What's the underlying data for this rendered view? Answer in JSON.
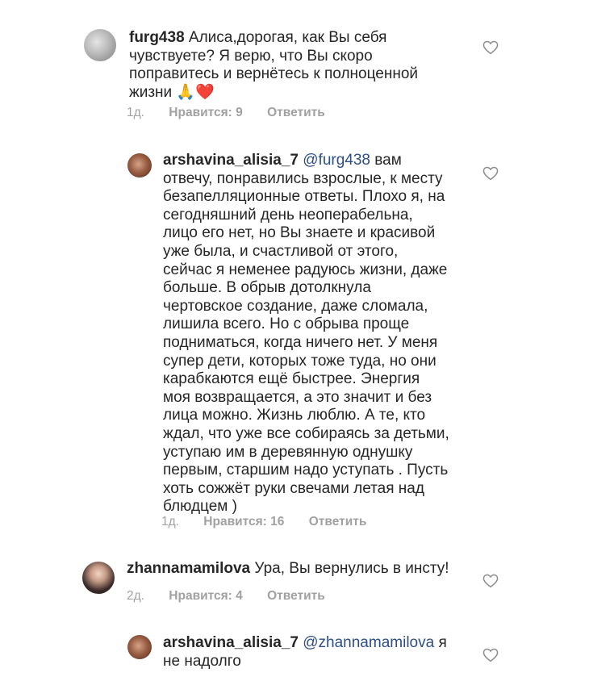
{
  "comments": [
    {
      "username": "furg438",
      "mention": "",
      "lines": [
        "Алиса,дорогая, как Вы себя",
        "чувствуете? Я верю, что Вы скоро",
        "поправитесь и вернётесь к полноценной",
        "жизни"
      ],
      "emoji": "🙏❤️",
      "age": "1д.",
      "likes": "Нравится: 9",
      "reply": "Ответить"
    },
    {
      "username": "arshavina_alisia_7",
      "mention": "@furg438",
      "lines": [
        "вам",
        "отвечу, понравились взрослые, к месту",
        "безапелляционные ответы. Плохо я, на",
        "сегодняшний день неоперабельна,",
        "лицо его нет, но Вы знаете и красивой",
        "уже была, и счастливой от этого,",
        "сейчас я неменее радуюсь жизни, даже",
        "больше. В обрыв дотолкнула",
        "чертовское создание, даже сломала,",
        "лишила всего. Но с обрыва проще",
        "подниматься, когда ничего нет. У меня",
        "супер дети, которых тоже туда, но они",
        "карабкаются ещё быстрее. Энергия",
        "моя возвращается, а это значит и без",
        "лица можно. Жизнь люблю. А те, кто",
        "ждал, что уже все собираясь за детьми,",
        "уступаю им в деревянную однушку",
        "первым, старшим надо уступать . Пусть",
        "хоть сожжёт руки свечами летая над",
        "блюдцем )"
      ],
      "age": "1д.",
      "likes": "Нравится: 16",
      "reply": "Ответить"
    },
    {
      "username": "zhannamamilova",
      "mention": "",
      "lines": [
        "Ура, Вы вернулись в инсту!"
      ],
      "age": "2д.",
      "likes": "Нравится: 4",
      "reply": "Ответить"
    },
    {
      "username": "arshavina_alisia_7",
      "mention": "@zhannamamilova",
      "lines": [
        "я",
        "не надолго"
      ],
      "age": "",
      "likes": "",
      "reply": ""
    }
  ],
  "icons": {
    "avatar": "user-avatar",
    "like": "heart-outline-icon"
  }
}
